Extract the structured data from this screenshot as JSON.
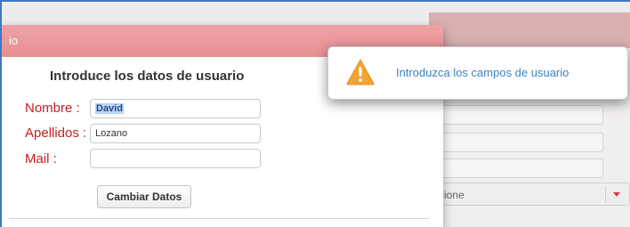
{
  "dialog": {
    "title": "io",
    "heading": "Introduce los datos de usuario",
    "fields": {
      "nombre": {
        "label": "Nombre :",
        "value": "David"
      },
      "apellidos": {
        "label": "Apellidos :",
        "value": "Lozano"
      },
      "mail": {
        "label": "Mail :",
        "value": ""
      }
    },
    "button_label": "Cambiar Datos"
  },
  "background_form": {
    "select_value": "cione"
  },
  "toast": {
    "icon": "warning-icon",
    "message": "Introduzca los campos de usuario"
  },
  "colors": {
    "header": "#e88f93",
    "label": "#c41e1e",
    "toast_text": "#3c82c4",
    "warning": "#f2a533",
    "frame": "#3f78c2"
  }
}
